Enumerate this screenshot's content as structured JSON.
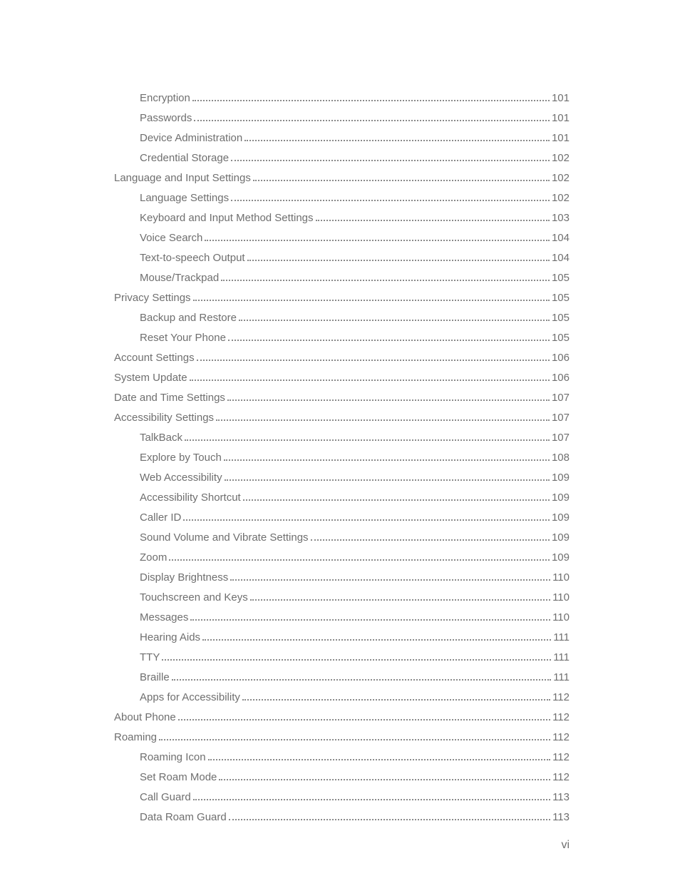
{
  "page_number_label": "vi",
  "toc": [
    {
      "label": "Encryption",
      "page": "101",
      "level": 2
    },
    {
      "label": "Passwords",
      "page": "101",
      "level": 2
    },
    {
      "label": "Device Administration",
      "page": "101",
      "level": 2
    },
    {
      "label": "Credential Storage",
      "page": "102",
      "level": 2
    },
    {
      "label": "Language and Input Settings",
      "page": "102",
      "level": 1
    },
    {
      "label": "Language Settings",
      "page": "102",
      "level": 2
    },
    {
      "label": "Keyboard and Input Method Settings",
      "page": "103",
      "level": 2
    },
    {
      "label": "Voice Search",
      "page": "104",
      "level": 2
    },
    {
      "label": "Text-to-speech Output",
      "page": "104",
      "level": 2
    },
    {
      "label": "Mouse/Trackpad",
      "page": "105",
      "level": 2
    },
    {
      "label": "Privacy Settings",
      "page": "105",
      "level": 1
    },
    {
      "label": "Backup and Restore",
      "page": "105",
      "level": 2
    },
    {
      "label": "Reset Your Phone",
      "page": "105",
      "level": 2
    },
    {
      "label": "Account Settings",
      "page": "106",
      "level": 1
    },
    {
      "label": "System Update",
      "page": "106",
      "level": 1
    },
    {
      "label": "Date and Time Settings",
      "page": "107",
      "level": 1
    },
    {
      "label": "Accessibility Settings",
      "page": "107",
      "level": 1
    },
    {
      "label": "TalkBack",
      "page": "107",
      "level": 2
    },
    {
      "label": "Explore by Touch",
      "page": "108",
      "level": 2
    },
    {
      "label": "Web Accessibility",
      "page": "109",
      "level": 2
    },
    {
      "label": "Accessibility Shortcut",
      "page": "109",
      "level": 2
    },
    {
      "label": "Caller ID",
      "page": "109",
      "level": 2
    },
    {
      "label": "Sound Volume and Vibrate Settings",
      "page": "109",
      "level": 2
    },
    {
      "label": "Zoom",
      "page": "109",
      "level": 2
    },
    {
      "label": "Display Brightness",
      "page": "110",
      "level": 2
    },
    {
      "label": "Touchscreen and Keys",
      "page": "110",
      "level": 2
    },
    {
      "label": "Messages",
      "page": "110",
      "level": 2
    },
    {
      "label": "Hearing Aids",
      "page": "111",
      "level": 2
    },
    {
      "label": "TTY",
      "page": "111",
      "level": 2
    },
    {
      "label": "Braille",
      "page": "111",
      "level": 2
    },
    {
      "label": "Apps for Accessibility",
      "page": "112",
      "level": 2
    },
    {
      "label": "About Phone",
      "page": "112",
      "level": 1
    },
    {
      "label": "Roaming",
      "page": "112",
      "level": 1
    },
    {
      "label": "Roaming Icon",
      "page": "112",
      "level": 2
    },
    {
      "label": "Set Roam Mode",
      "page": "112",
      "level": 2
    },
    {
      "label": "Call Guard",
      "page": "113",
      "level": 2
    },
    {
      "label": "Data Roam Guard",
      "page": "113",
      "level": 2
    }
  ]
}
